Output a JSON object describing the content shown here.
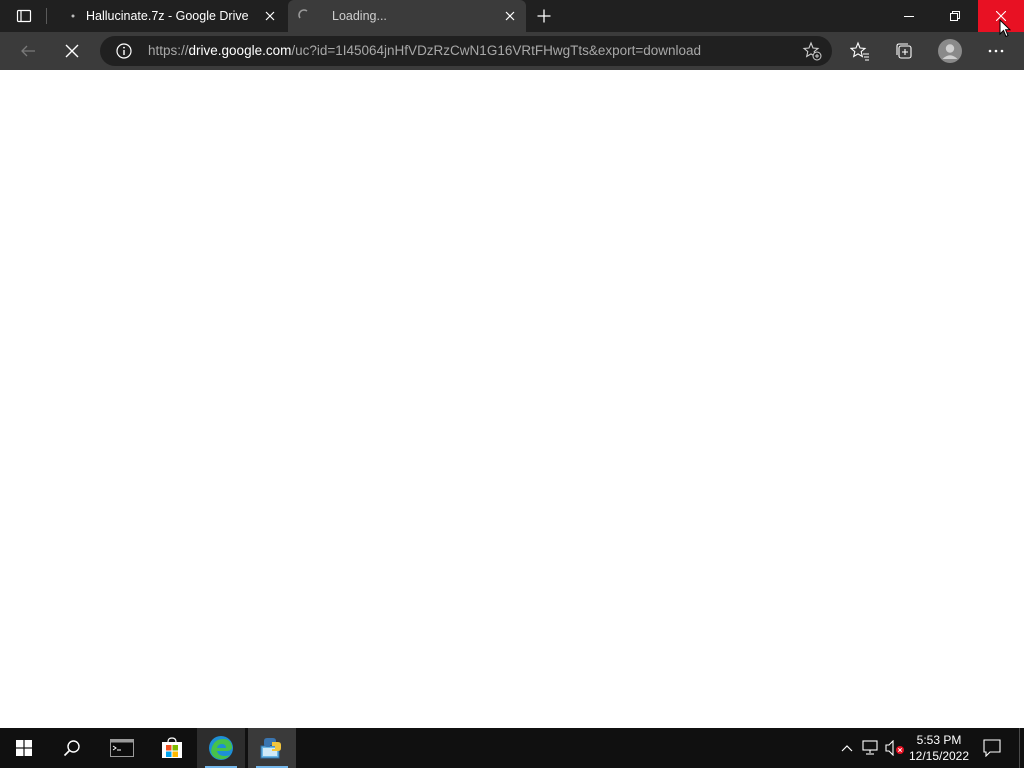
{
  "browser": {
    "tabs": [
      {
        "title": "Hallucinate.7z - Google Drive",
        "active": false
      },
      {
        "title": "Loading...",
        "active": true
      }
    ],
    "address": {
      "url_prefix": "https://",
      "url_host": "drive.google.com",
      "url_path": "/uc?id=1I45064jnHfVDzRzCwN1G16VRtFHwgTts&export=download"
    },
    "loading": true
  },
  "taskbar": {
    "clock": {
      "time": "5:53 PM",
      "date": "12/15/2022"
    },
    "apps": [
      "start-icon",
      "search-icon",
      "terminal-icon",
      "store-icon",
      "edge-icon",
      "python-app-icon"
    ]
  },
  "colors": {
    "tabstrip": "#202020",
    "toolbar": "#3b3b3b",
    "close_hover": "#e81123",
    "taskbar": "#101010",
    "active_indicator": "#76b9ed"
  }
}
